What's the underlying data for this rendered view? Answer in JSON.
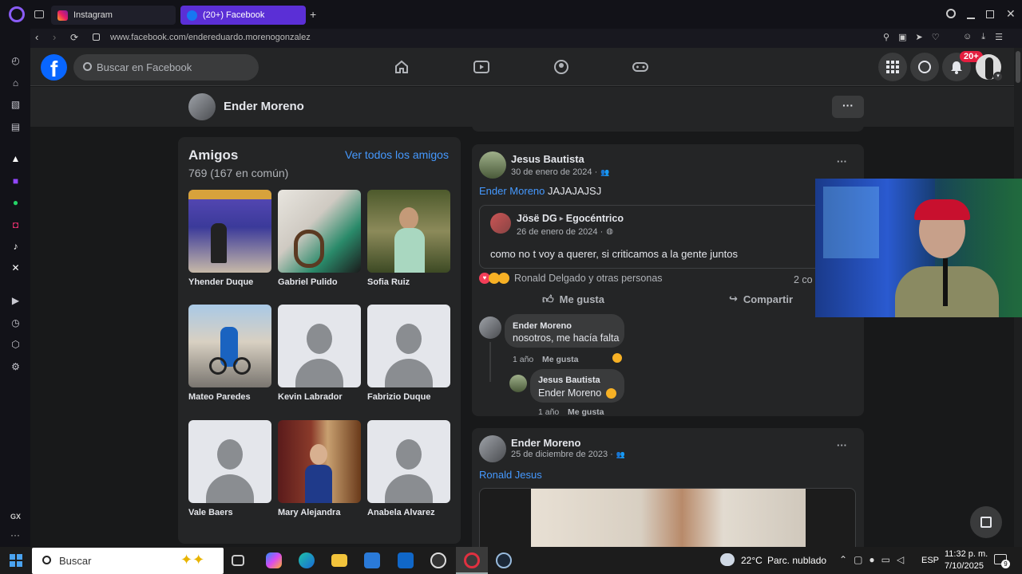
{
  "browser": {
    "tabs": [
      {
        "label": "Instagram",
        "active": false
      },
      {
        "label": "(20+) Facebook",
        "active": true
      }
    ],
    "url": "www.facebook.com/endereduardo.morenogonzalez",
    "sidebar_bottom_label": "GX",
    "more_label": "···"
  },
  "facebook": {
    "search_placeholder": "Buscar en Facebook",
    "notifications_badge": "20+",
    "profile_name": "Ender Moreno",
    "friends_card": {
      "title": "Amigos",
      "count": "769 (167 en común)",
      "see_all": "Ver todos los amigos",
      "friends": [
        {
          "name": "Yhender Duque"
        },
        {
          "name": "Gabriel Pulido"
        },
        {
          "name": "Sofia Ruiz"
        },
        {
          "name": "Mateo Paredes"
        },
        {
          "name": "Kevin Labrador"
        },
        {
          "name": "Fabrizio Duque"
        },
        {
          "name": "Vale Baers"
        },
        {
          "name": "Mary Alejandra"
        },
        {
          "name": "Anabela Alvarez"
        }
      ]
    },
    "post1": {
      "author": "Jesus Bautista",
      "date": "30 de enero de 2024 ·",
      "tag": "Ender Moreno",
      "text": "JAJAJAJSJ",
      "shared": {
        "author": "Jösë DG",
        "arrow": "▸",
        "target": "Egocéntrico",
        "date": "26 de enero de 2024 ·",
        "text": "como no t voy a querer, si criticamos a la gente juntos"
      },
      "reactions_text": "Ronald Delgado y otras personas",
      "comments_count": "2 co",
      "like_label": "Me gusta",
      "share_label": "Compartir",
      "comments": [
        {
          "author": "Ender Moreno",
          "text": "nosotros, me hacía falta",
          "time": "1 año",
          "like": "Me gusta"
        },
        {
          "author": "Jesus Bautista",
          "text": "Ender Moreno",
          "time": "1 año",
          "like": "Me gusta"
        }
      ]
    },
    "post2": {
      "author": "Ender Moreno",
      "date": "25 de diciembre de 2023 ·",
      "tag": "Ronald Jesus"
    }
  },
  "taskbar": {
    "search_label": "Buscar",
    "weather_temp": "22°C",
    "weather_text": "Parc. nublado",
    "lang": "ESP",
    "time": "11:32 p. m.",
    "date": "7/10/2025",
    "notif_count": "9"
  },
  "colors": {
    "fb_blue": "#0866ff",
    "link": "#4599ff",
    "badge_red": "#e41e3f",
    "tab_active": "#5b2fd6"
  }
}
